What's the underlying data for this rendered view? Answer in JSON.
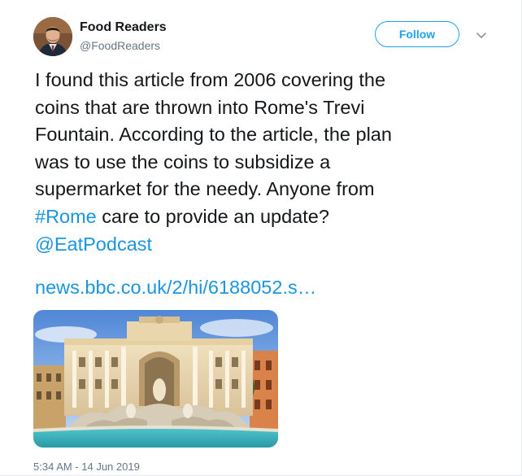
{
  "author": {
    "name": "Food Readers",
    "handle": "@FoodReaders"
  },
  "follow_button": {
    "label": "Follow"
  },
  "menu": {
    "icon": "chevron-down-icon"
  },
  "tweet": {
    "lines": [
      "I found this article from 2006 covering the",
      "coins that are thrown into Rome's Trevi",
      "Fountain. According to the article, the plan",
      "was to use the coins to subsidize a",
      "supermarket for the needy. Anyone from"
    ],
    "hashtag": "#Rome",
    "line6_rest": " care to provide an update?",
    "mention": "@EatPodcast",
    "url": "news.bbc.co.uk/2/hi/6188052.s…"
  },
  "card": {
    "image": "trevi-fountain-photo"
  },
  "timestamp": "5:34 AM - 14 Jun 2019",
  "colors": {
    "accent": "#1da1f2",
    "link": "#1b95e0",
    "text": "#14171a",
    "muted": "#657786"
  }
}
